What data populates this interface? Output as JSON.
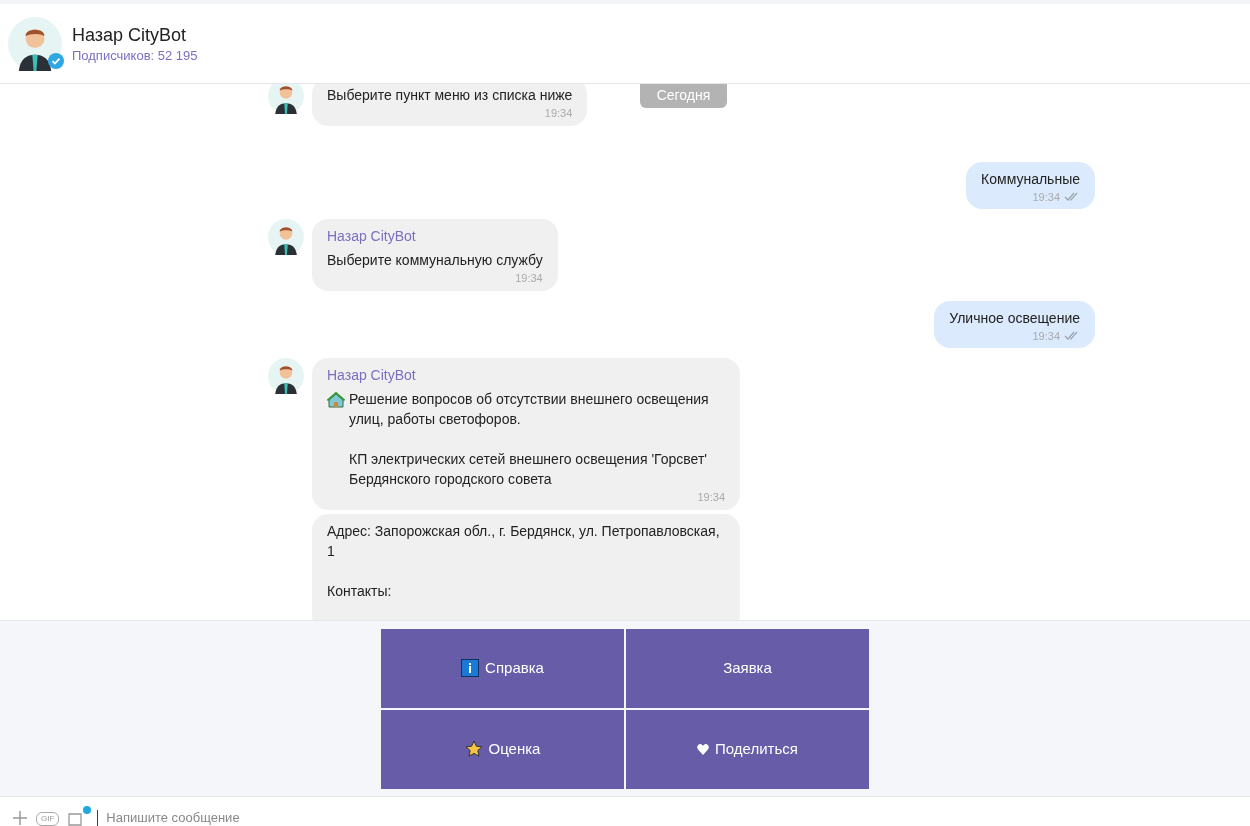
{
  "header": {
    "title": "Назар CityBot",
    "subtitle": "Подписчиков: 52 195",
    "verified": true
  },
  "date_badge": "Сегодня",
  "messages": [
    {
      "kind": "incoming",
      "avatar": true,
      "text": "Выберите пункт меню из списка ниже",
      "time": "19:34"
    },
    {
      "kind": "outgoing",
      "text": "Коммунальные",
      "time": "19:34",
      "read": true
    },
    {
      "kind": "incoming",
      "avatar": true,
      "sender": "Назар CityBot",
      "text": "Выберите коммунальную службу",
      "time": "19:34"
    },
    {
      "kind": "outgoing",
      "text": "Уличное освещение",
      "time": "19:34",
      "read": true
    },
    {
      "kind": "incoming",
      "avatar": true,
      "sender": "Назар CityBot",
      "icon": true,
      "text": "Решение вопросов об отсутствии внешнего освещения улиц, работы светофоров.\n\nКП электрических сетей внешнего освещения 'Горсвет' Бердянского городского совета",
      "time": "19:34"
    },
    {
      "kind": "incoming",
      "avatar": false,
      "text": "Адрес: Запорожская обл., г. Бердянск, ул. Петропавловская, 1\n\nКонтакты:"
    }
  ],
  "keyboard": [
    {
      "kind": "info",
      "label": "Справка"
    },
    {
      "kind": "plain",
      "label": "Заявка"
    },
    {
      "kind": "star",
      "label": "Оценка"
    },
    {
      "kind": "heart",
      "label": "Поделиться"
    }
  ],
  "composer": {
    "gif": "GIF",
    "sticker_dot": true,
    "placeholder": "Напишите сообщение"
  }
}
